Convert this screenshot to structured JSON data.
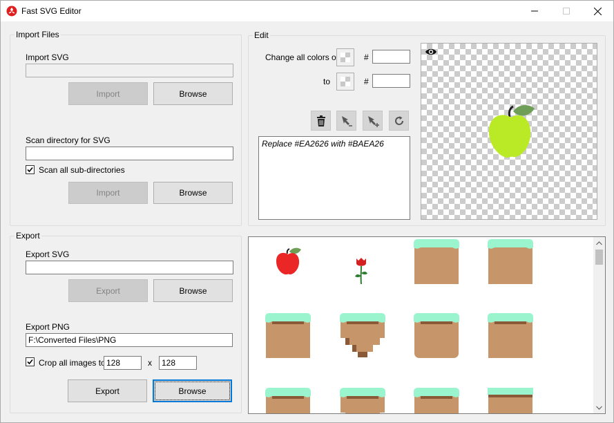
{
  "window": {
    "title": "Fast SVG Editor",
    "controls": {
      "minimize": "minimize-icon",
      "maximize": "maximize-icon",
      "close": "close-icon"
    }
  },
  "import_files": {
    "group_label": "Import Files",
    "svg": {
      "label": "Import SVG",
      "value": "",
      "import_label": "Import",
      "browse_label": "Browse"
    },
    "scan": {
      "label": "Scan directory for SVG",
      "value": "",
      "checkbox_label": "Scan all sub-directories",
      "checked": true,
      "import_label": "Import",
      "browse_label": "Browse"
    }
  },
  "edit": {
    "group_label": "Edit",
    "change_from_label": "Change all colors of",
    "to_label": "to",
    "hash": "#",
    "from_hex": "",
    "to_hex": "",
    "tools": [
      "delete-icon",
      "pen-remove-icon",
      "pen-add-icon",
      "refresh-icon"
    ],
    "log": [
      "Replace #EA2626 with #BAEA26"
    ],
    "preview_icon": "eye-icon",
    "preview_fruit_color": "#BAEA26"
  },
  "export": {
    "group_label": "Export",
    "svg": {
      "label": "Export SVG",
      "value": "",
      "export_label": "Export",
      "browse_label": "Browse"
    },
    "png": {
      "label": "Export PNG",
      "value": "F:\\Converted Files\\PNG",
      "crop_label": "Crop all images to",
      "crop_checked": true,
      "width": "128",
      "x_label": "x",
      "height": "128",
      "export_label": "Export",
      "browse_label": "Browse"
    }
  },
  "gallery": {
    "items": [
      "apple",
      "rose",
      "ground-block",
      "ground-block",
      "ground-block",
      "ground-floating",
      "ground-block",
      "ground-block",
      "ground-block",
      "ground-floating",
      "ground-block",
      "ground-block"
    ]
  },
  "colors": {
    "accent": "#0078d7",
    "apple_red": "#EA2626",
    "grass": "#9AF5CF",
    "dirt": "#C6956A",
    "dirt_dark": "#8A5A38"
  }
}
